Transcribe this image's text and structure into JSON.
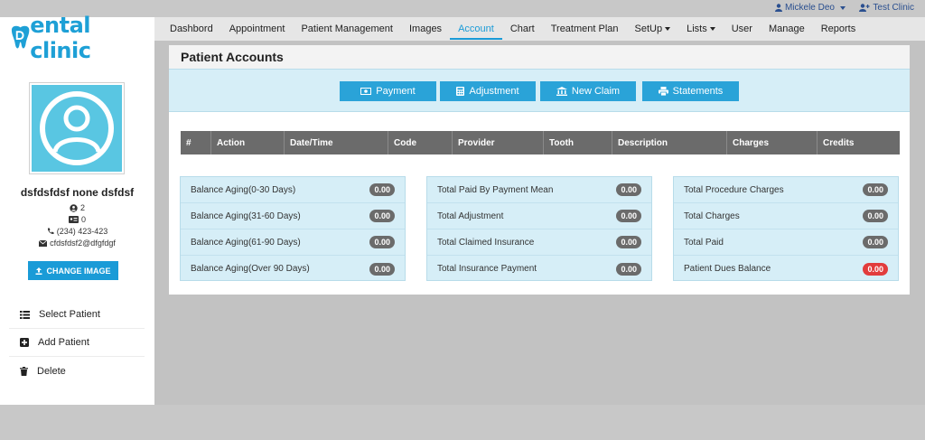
{
  "topbar": {
    "user": "Mickele Deo",
    "clinic": "Test Clinic"
  },
  "logo": {
    "text": "ental clinic"
  },
  "nav": [
    {
      "label": "Dashbord"
    },
    {
      "label": "Appointment"
    },
    {
      "label": "Patient Management"
    },
    {
      "label": "Images"
    },
    {
      "label": "Account",
      "active": true
    },
    {
      "label": "Chart"
    },
    {
      "label": "Treatment Plan"
    },
    {
      "label": "SetUp",
      "dropdown": true
    },
    {
      "label": "Lists",
      "dropdown": true
    },
    {
      "label": "User"
    },
    {
      "label": "Manage"
    },
    {
      "label": "Reports"
    }
  ],
  "patient": {
    "name": "dsfdsfdsf none dsfdsf",
    "count1": "2",
    "count2": "0",
    "phone": "(234) 423-423",
    "email": "cfdsfdsf2@dfgfdgf",
    "change_image_label": "CHANGE IMAGE"
  },
  "side_menu": {
    "select": "Select Patient",
    "add": "Add Patient",
    "delete": "Delete"
  },
  "panel": {
    "title": "Patient Accounts",
    "buttons": {
      "payment": "Payment",
      "adjustment": "Adjustment",
      "new_claim": "New Claim",
      "statements": "Statements"
    },
    "table_headers": [
      "#",
      "Action",
      "Date/Time",
      "Code",
      "Provider",
      "Tooth",
      "Description",
      "Charges",
      "Credits"
    ]
  },
  "summary": {
    "aging": [
      {
        "label": "Balance Aging(0-30 Days)",
        "value": "0.00"
      },
      {
        "label": "Balance Aging(31-60 Days)",
        "value": "0.00"
      },
      {
        "label": "Balance Aging(61-90 Days)",
        "value": "0.00"
      },
      {
        "label": "Balance Aging(Over 90 Days)",
        "value": "0.00"
      }
    ],
    "payments": [
      {
        "label": "Total Paid By Payment Mean",
        "value": "0.00"
      },
      {
        "label": "Total Adjustment",
        "value": "0.00"
      },
      {
        "label": "Total Claimed Insurance",
        "value": "0.00"
      },
      {
        "label": "Total Insurance Payment",
        "value": "0.00"
      }
    ],
    "totals": [
      {
        "label": "Total Procedure Charges",
        "value": "0.00"
      },
      {
        "label": "Total Charges",
        "value": "0.00"
      },
      {
        "label": "Total Paid",
        "value": "0.00"
      },
      {
        "label": "Patient Dues Balance",
        "value": "0.00",
        "status": "alert"
      }
    ]
  },
  "colors": {
    "accent": "#1a9bd7",
    "panel_blue": "#d6eef7",
    "badge_gray": "#6b6b6b",
    "badge_red": "#e23c3c"
  }
}
